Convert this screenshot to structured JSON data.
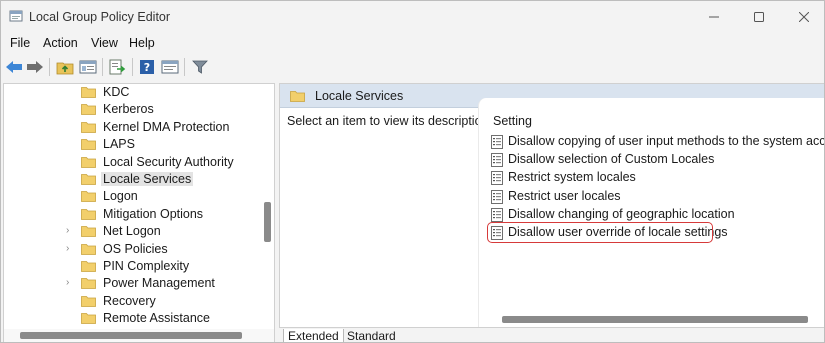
{
  "window": {
    "title": "Local Group Policy Editor"
  },
  "menu": [
    "File",
    "Action",
    "View",
    "Help"
  ],
  "toolbar": {
    "icons": [
      "back-arrow-icon",
      "forward-arrow-icon",
      "up-folder-icon",
      "show-hide-tree-icon",
      "export-list-icon",
      "help-icon",
      "properties-icon",
      "filter-icon"
    ]
  },
  "tree": {
    "items": [
      {
        "label": "KDC",
        "expandable": false
      },
      {
        "label": "Kerberos",
        "expandable": false
      },
      {
        "label": "Kernel DMA Protection",
        "expandable": false
      },
      {
        "label": "LAPS",
        "expandable": false
      },
      {
        "label": "Local Security Authority",
        "expandable": false
      },
      {
        "label": "Locale Services",
        "expandable": false,
        "selected": true
      },
      {
        "label": "Logon",
        "expandable": false
      },
      {
        "label": "Mitigation Options",
        "expandable": false
      },
      {
        "label": "Net Logon",
        "expandable": true
      },
      {
        "label": "OS Policies",
        "expandable": true
      },
      {
        "label": "PIN Complexity",
        "expandable": false
      },
      {
        "label": "Power Management",
        "expandable": true
      },
      {
        "label": "Recovery",
        "expandable": false
      },
      {
        "label": "Remote Assistance",
        "expandable": false
      }
    ],
    "expander_glyph": "›"
  },
  "details": {
    "header_title": "Locale Services",
    "description": "Select an item to view its description.",
    "column_header": "Setting",
    "settings": [
      "Disallow copying of user input methods to the system accou...",
      "Disallow selection of Custom Locales",
      "Restrict system locales",
      "Restrict user locales",
      "Disallow changing of geographic location",
      "Disallow user override of locale settings"
    ],
    "highlighted_index": 5
  },
  "tabs": [
    "Extended",
    "Standard"
  ],
  "colors": {
    "highlight": "#d63a3a",
    "header_bg": "#d9e3ef",
    "folder": "#f2cf6b"
  }
}
